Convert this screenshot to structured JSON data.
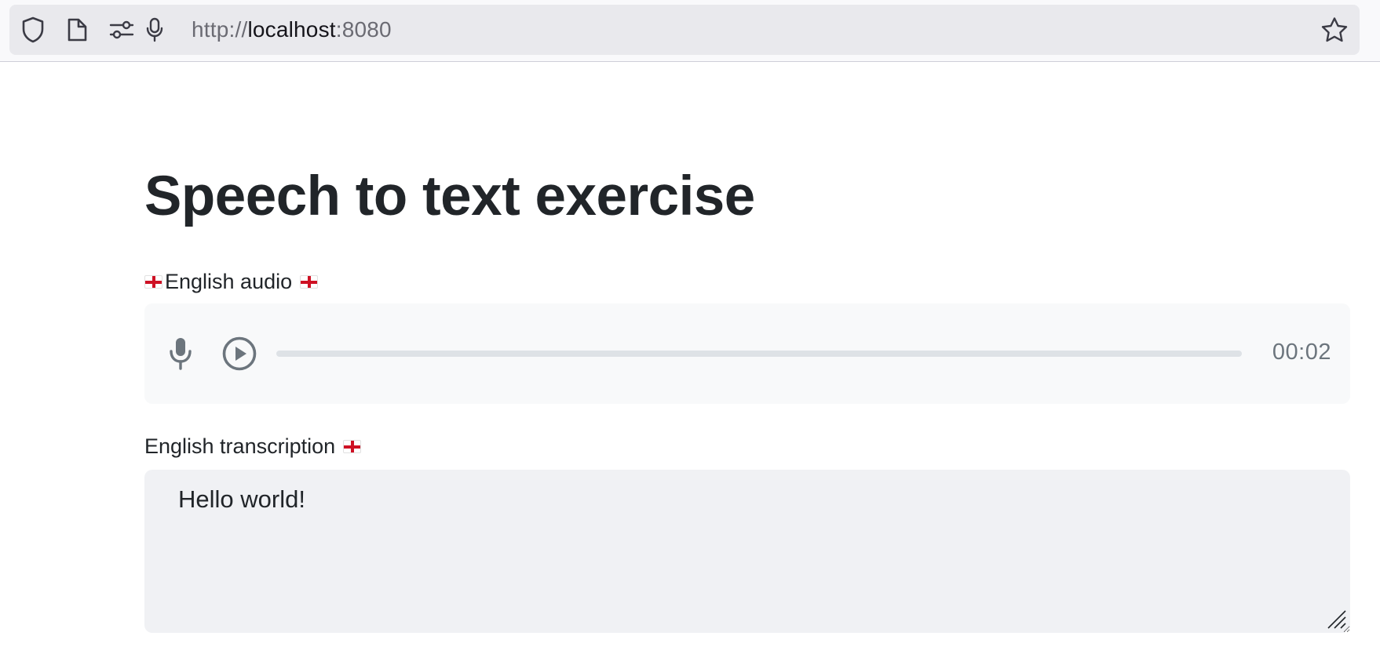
{
  "browser": {
    "url_scheme": "http://",
    "url_host": "localhost",
    "url_port": ":8080",
    "icons": [
      "shield-icon",
      "page-icon",
      "permissions-icon",
      "microphone-icon",
      "bookmark-star-icon"
    ]
  },
  "page": {
    "title": "Speech to text exercise",
    "audio_section": {
      "label": "English audio",
      "flag": "england-flag",
      "time": "00:02",
      "progress": 0
    },
    "transcription_section": {
      "label": "English transcription",
      "flag": "england-flag",
      "value": "Hello world!"
    }
  },
  "colors": {
    "flag_red": "#ce1124",
    "text": "#212529",
    "muted": "#6c757d",
    "audio_bg": "#f8f9fa",
    "textarea_bg": "#f0f1f4"
  }
}
